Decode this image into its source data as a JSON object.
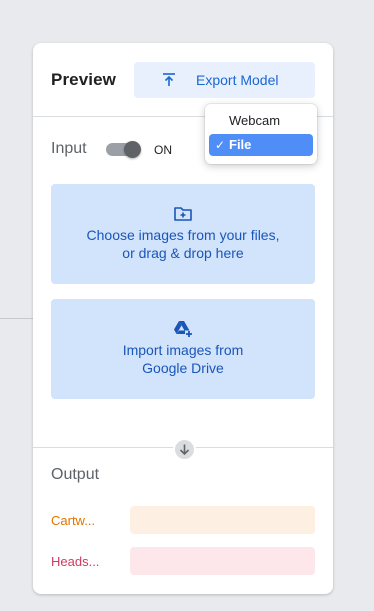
{
  "panel": {
    "title": "Preview",
    "export_label": "Export Model"
  },
  "input": {
    "label": "Input",
    "toggle_state": "ON",
    "toggle_on": true,
    "source_options": [
      "Webcam",
      "File"
    ],
    "selected_source": "File"
  },
  "upload": {
    "files_text_line1": "Choose images from your files,",
    "files_text_line2": "or drag & drop here",
    "drive_text_line1": "Import images from",
    "drive_text_line2": "Google Drive"
  },
  "output": {
    "title": "Output",
    "classes": [
      {
        "name": "Cartw...",
        "color": "#e37400",
        "bar_color": "#feefe3"
      },
      {
        "name": "Heads...",
        "color": "#d03b5c",
        "bar_color": "#fde7ea"
      }
    ]
  },
  "colors": {
    "accent": "#1967d2",
    "selected_option": "#4f8ef7"
  },
  "icons": {
    "export": "upload-arrow-icon",
    "files": "folder-plus-icon",
    "drive": "google-drive-add-icon",
    "output_arrow": "arrow-down-icon",
    "check": "checkmark-icon"
  }
}
